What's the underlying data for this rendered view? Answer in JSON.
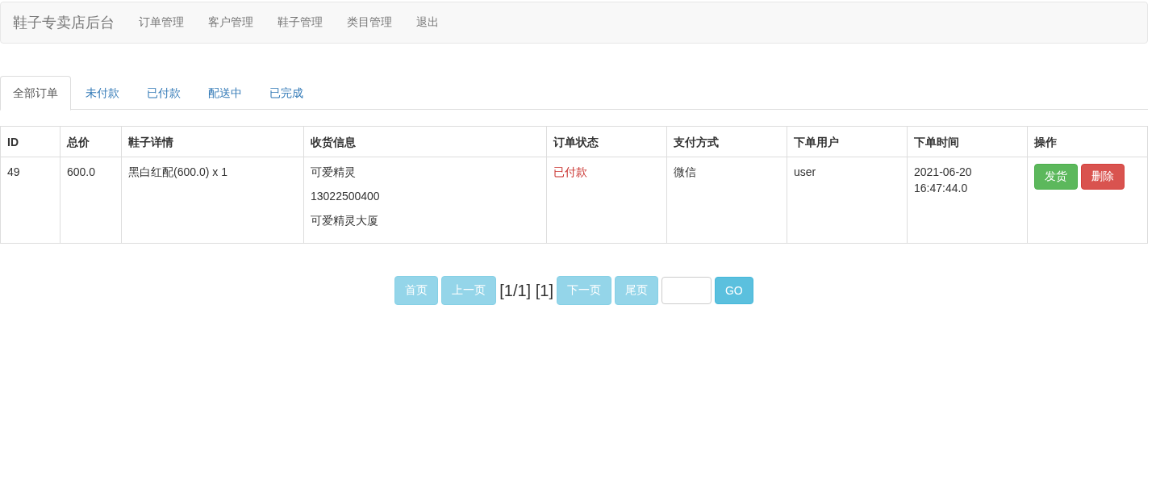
{
  "navbar": {
    "brand": "鞋子专卖店后台",
    "items": [
      "订单管理",
      "客户管理",
      "鞋子管理",
      "类目管理",
      "退出"
    ]
  },
  "tabs": [
    {
      "label": "全部订单",
      "selected": true
    },
    {
      "label": "未付款",
      "selected": false
    },
    {
      "label": "已付款",
      "selected": false
    },
    {
      "label": "配送中",
      "selected": false
    },
    {
      "label": "已完成",
      "selected": false
    }
  ],
  "table": {
    "columns": [
      "ID",
      "总价",
      "鞋子详情",
      "收货信息",
      "订单状态",
      "支付方式",
      "下单用户",
      "下单时间",
      "操作"
    ],
    "rows": [
      {
        "id": "49",
        "total": "600.0",
        "detail": "黑白红配(600.0) x 1",
        "receiver": [
          "可爱精灵",
          "13022500400",
          "可爱精灵大厦"
        ],
        "status": {
          "text": "已付款",
          "kind": "danger"
        },
        "payment": "微信",
        "user": "user",
        "time": "2021-06-20 16:47:44.0",
        "actions": [
          {
            "label": "发货",
            "kind": "success"
          },
          {
            "label": "删除",
            "kind": "danger"
          }
        ]
      }
    ]
  },
  "pagination": {
    "first": {
      "label": "首页",
      "disabled": true
    },
    "prev": {
      "label": "上一页",
      "disabled": true
    },
    "info": "[1/1] [1]",
    "next": {
      "label": "下一页",
      "disabled": true
    },
    "last": {
      "label": "尾页",
      "disabled": true
    },
    "go": {
      "label": "GO",
      "disabled": false
    }
  }
}
